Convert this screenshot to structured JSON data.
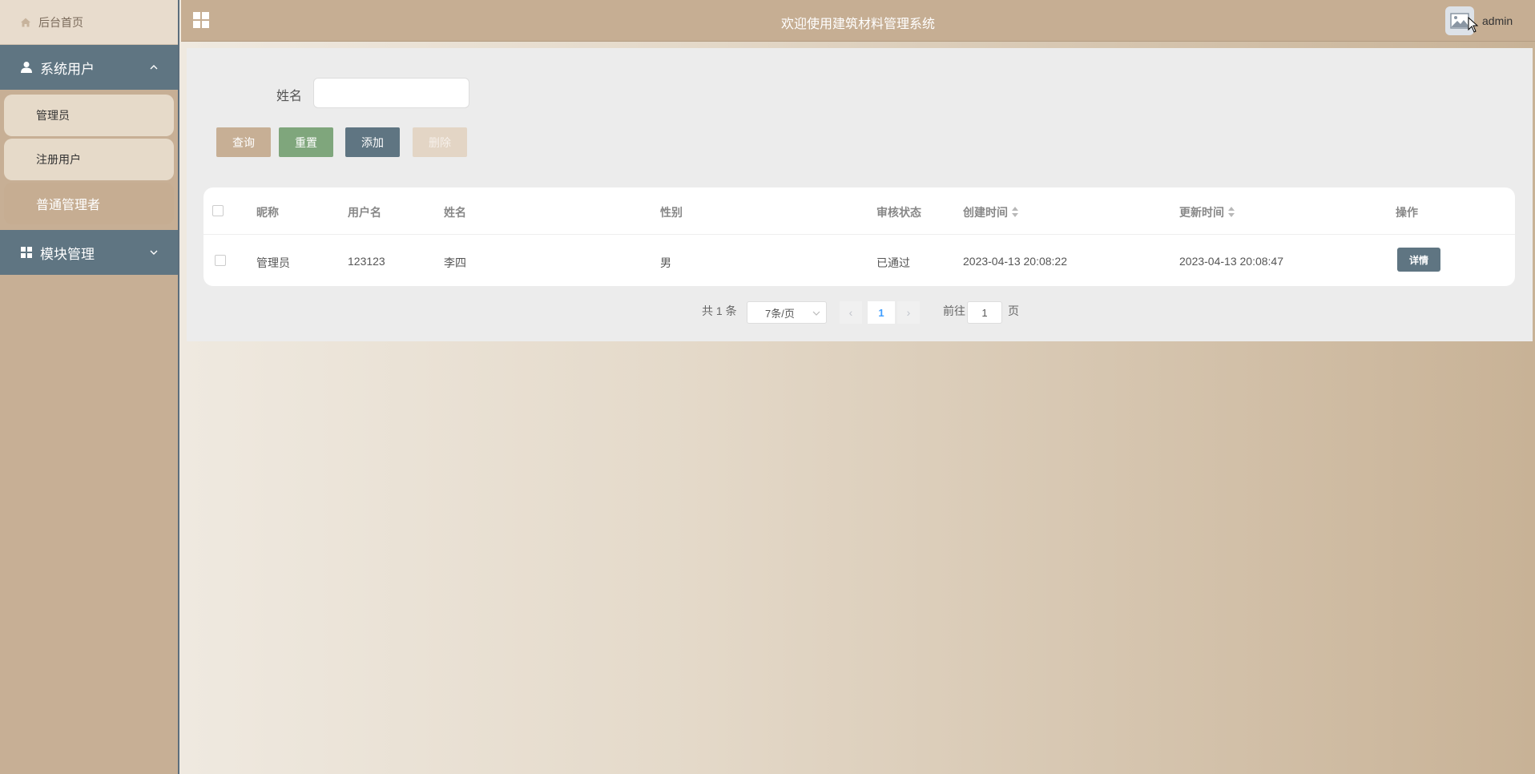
{
  "sidebar": {
    "home_label": "后台首页",
    "groups": [
      {
        "label": "系统用户",
        "expanded": true,
        "items": [
          {
            "label": "管理员"
          },
          {
            "label": "注册用户"
          },
          {
            "label": "普通管理者",
            "active": true
          }
        ]
      },
      {
        "label": "模块管理",
        "expanded": false
      }
    ]
  },
  "header": {
    "title": "欢迎使用建筑材料管理系统",
    "username": "admin"
  },
  "search": {
    "name_label": "姓名",
    "name_value": "",
    "name_placeholder": ""
  },
  "actions": {
    "query": "查询",
    "reset": "重置",
    "add": "添加",
    "delete": "删除"
  },
  "table": {
    "columns": [
      "昵称",
      "用户名",
      "姓名",
      "性别",
      "审核状态",
      "创建时间",
      "更新时间",
      "操作"
    ],
    "rows": [
      {
        "nickname": "管理员",
        "username": "123123",
        "name": "李四",
        "gender": "男",
        "status": "已通过",
        "created": "2023-04-13 20:08:22",
        "updated": "2023-04-13 20:08:47",
        "action": "详情"
      }
    ]
  },
  "pagination": {
    "total": "共 1 条",
    "page_size": "7条/页",
    "prev": "‹",
    "current_page": "1",
    "next": "›",
    "goto_label": "前往",
    "goto_value": "1",
    "page_suffix": "页"
  },
  "colors": {
    "accent": "#c7af95",
    "slate": "#5f7582",
    "green": "#7fa67c"
  }
}
